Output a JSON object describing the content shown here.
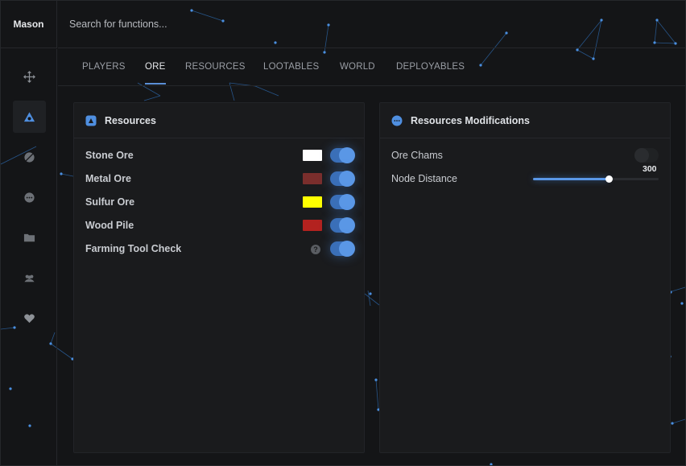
{
  "brand": {
    "title": "Mason"
  },
  "search": {
    "placeholder": "Search for functions..."
  },
  "sidebar": {
    "items": [
      {
        "icon": "move-icon",
        "active": false
      },
      {
        "icon": "eye-triangle-icon",
        "active": true
      },
      {
        "icon": "crosshair-ball-icon",
        "active": false
      },
      {
        "icon": "chat-dots-icon",
        "active": false
      },
      {
        "icon": "folder-icon",
        "active": false
      },
      {
        "icon": "users-icon",
        "active": false
      },
      {
        "icon": "heart-icon",
        "active": false
      }
    ]
  },
  "tabs": [
    {
      "label": "PLAYERS",
      "active": false
    },
    {
      "label": "ORE",
      "active": true
    },
    {
      "label": "RESOURCES",
      "active": false
    },
    {
      "label": "LOOTABLES",
      "active": false
    },
    {
      "label": "WORLD",
      "active": false
    },
    {
      "label": "DEPLOYABLES",
      "active": false
    }
  ],
  "panel_left": {
    "title": "Resources",
    "icon": "resources-icon",
    "rows": [
      {
        "label": "Stone Ore",
        "color": "#ffffff",
        "enabled": true
      },
      {
        "label": "Metal Ore",
        "color": "#7a2e2c",
        "enabled": true
      },
      {
        "label": "Sulfur Ore",
        "color": "#ffff00",
        "enabled": true
      },
      {
        "label": "Wood Pile",
        "color": "#b3221f",
        "enabled": true
      },
      {
        "label": "Farming Tool Check",
        "help": "?",
        "enabled": true
      }
    ]
  },
  "panel_right": {
    "title": "Resources Modifications",
    "icon": "chat-bubble-icon",
    "ore_chams": {
      "label": "Ore Chams",
      "enabled": false
    },
    "node_distance": {
      "label": "Node Distance",
      "value": "300",
      "fraction": 0.6
    }
  },
  "colors": {
    "accent": "#5a97e6",
    "panel": "#1a1b1d",
    "background": "#141517"
  }
}
